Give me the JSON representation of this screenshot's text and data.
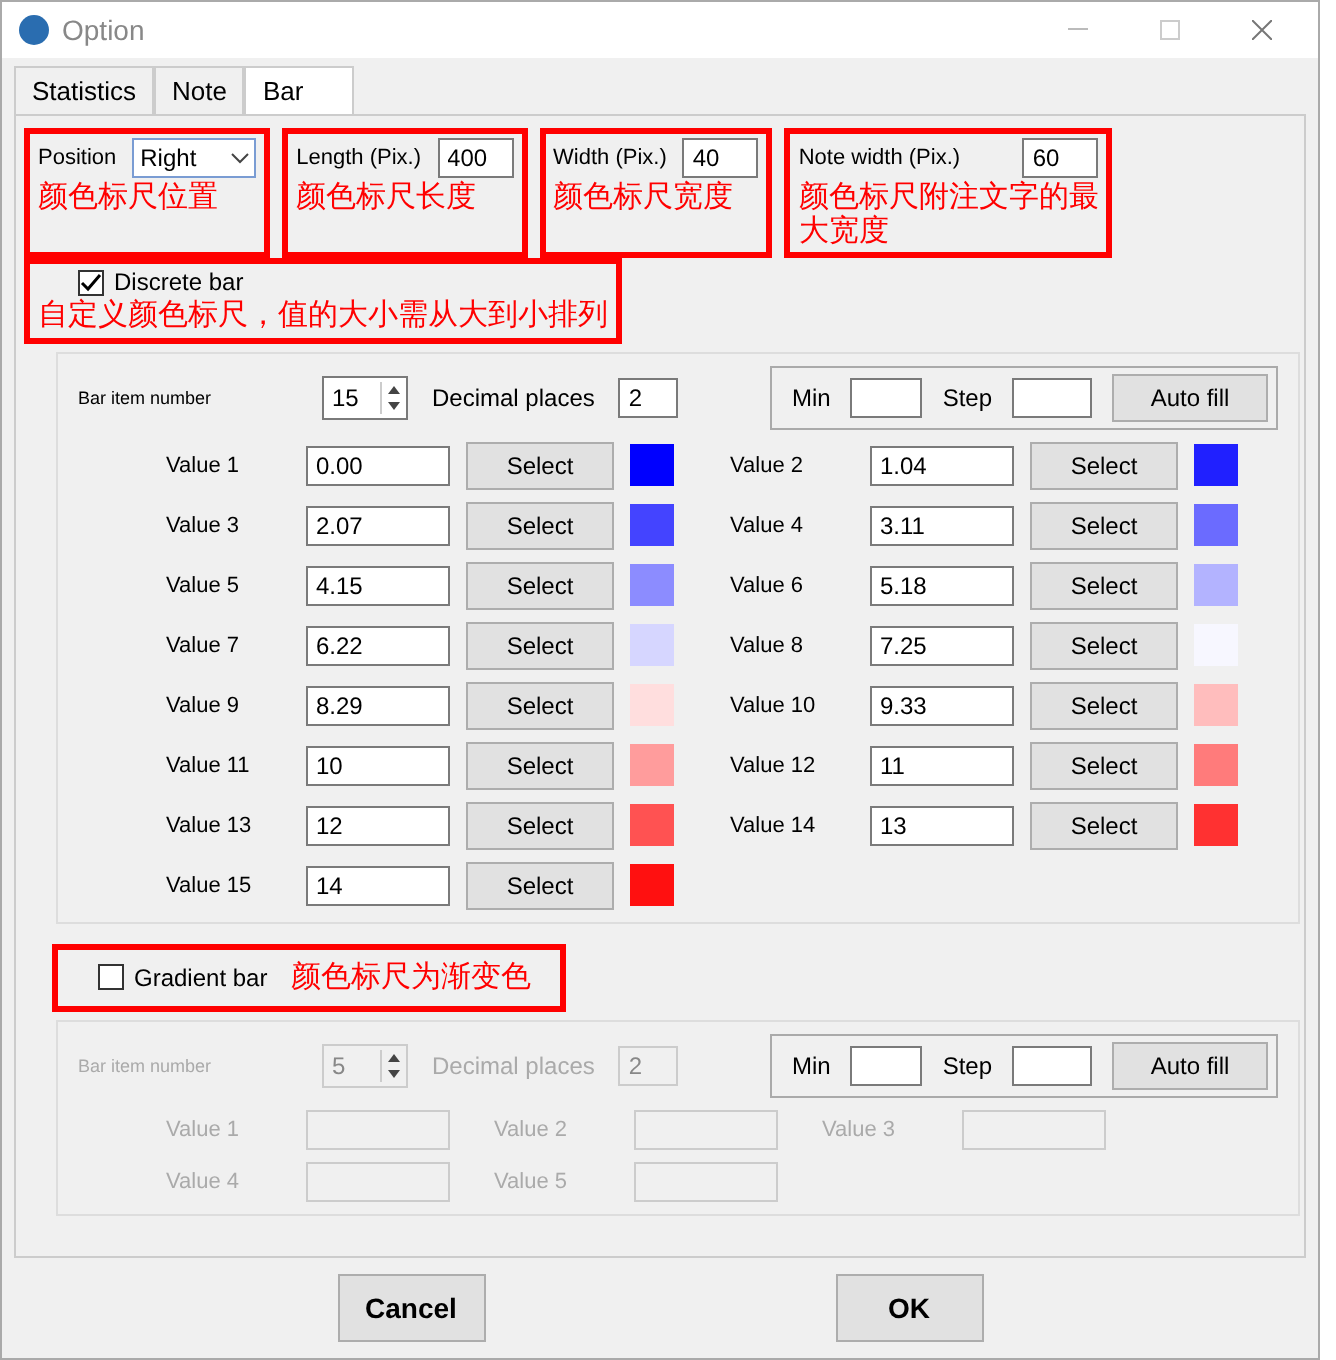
{
  "window": {
    "title": "Option"
  },
  "tabs": [
    {
      "label": "Statistics",
      "selected": false
    },
    {
      "label": "Note",
      "selected": false
    },
    {
      "label": "Bar",
      "selected": true
    }
  ],
  "settings": [
    {
      "kind": "select",
      "label": "Position",
      "value": "Right",
      "annotation": "颜色标尺位置"
    },
    {
      "kind": "number",
      "label": "Length (Pix.)",
      "value": "400",
      "annotation": "颜色标尺长度"
    },
    {
      "kind": "number",
      "label": "Width (Pix.)",
      "value": "40",
      "annotation": "颜色标尺宽度"
    },
    {
      "kind": "number",
      "label": "Note width (Pix.)",
      "value": "60",
      "annotation": "颜色标尺附注文字的最大宽度"
    }
  ],
  "discrete": {
    "label": "Discrete bar",
    "checked": true,
    "annotation": "自定义颜色标尺，值的大小需从大到小排列",
    "disabled": false,
    "item_number_label": "Bar item number",
    "item_number": "15",
    "decimal_label": "Decimal places",
    "decimal": "2",
    "min_label": "Min",
    "step_label": "Step",
    "autofill": "Auto fill",
    "values": [
      {
        "label": "Value 1",
        "value": "0.00",
        "button": "Select",
        "color": "#0000ff"
      },
      {
        "label": "Value 2",
        "value": "1.04",
        "button": "Select",
        "color": "#2020ff"
      },
      {
        "label": "Value 3",
        "value": "2.07",
        "button": "Select",
        "color": "#4444ff"
      },
      {
        "label": "Value 4",
        "value": "3.11",
        "button": "Select",
        "color": "#6b6bff"
      },
      {
        "label": "Value 5",
        "value": "4.15",
        "button": "Select",
        "color": "#8c8cff"
      },
      {
        "label": "Value 6",
        "value": "5.18",
        "button": "Select",
        "color": "#b3b3ff"
      },
      {
        "label": "Value 7",
        "value": "6.22",
        "button": "Select",
        "color": "#d6d6ff"
      },
      {
        "label": "Value 8",
        "value": "7.25",
        "button": "Select",
        "color": "#f7f7ff"
      },
      {
        "label": "Value 9",
        "value": "8.29",
        "button": "Select",
        "color": "#ffdede"
      },
      {
        "label": "Value 10",
        "value": "9.33",
        "button": "Select",
        "color": "#ffbdbd"
      },
      {
        "label": "Value 11",
        "value": "10",
        "button": "Select",
        "color": "#ff9c9c"
      },
      {
        "label": "Value 12",
        "value": "11",
        "button": "Select",
        "color": "#ff7b7b"
      },
      {
        "label": "Value 13",
        "value": "12",
        "button": "Select",
        "color": "#ff5252"
      },
      {
        "label": "Value 14",
        "value": "13",
        "button": "Select",
        "color": "#ff3131"
      },
      {
        "label": "Value 15",
        "value": "14",
        "button": "Select",
        "color": "#ff1010"
      }
    ]
  },
  "gradient": {
    "label": "Gradient bar",
    "checked": false,
    "annotation": "颜色标尺为渐变色",
    "disabled": true,
    "item_number_label": "Bar item number",
    "item_number": "5",
    "decimal_label": "Decimal places",
    "decimal": "2",
    "min_label": "Min",
    "step_label": "Step",
    "autofill": "Auto fill",
    "values": [
      {
        "label": "Value 1"
      },
      {
        "label": "Value 2"
      },
      {
        "label": "Value 3"
      },
      {
        "label": "Value 4"
      },
      {
        "label": "Value 5"
      }
    ]
  },
  "buttons": [
    {
      "label": "Cancel"
    },
    {
      "label": "OK"
    }
  ]
}
